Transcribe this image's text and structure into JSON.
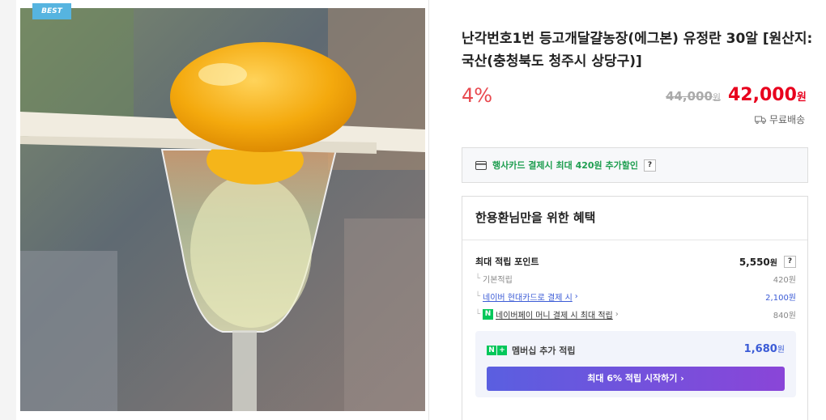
{
  "badge": "BEST",
  "product": {
    "title": "난각번호1번 등고개달걀농장(에그본) 유정란 30알 [원산지:국산(충청북도 청주시 상당구)]",
    "discount": "4%",
    "original_price": "44,000",
    "original_unit": "원",
    "sale_price": "42,000",
    "sale_unit": "원",
    "shipping": "무료배송"
  },
  "card_offer": {
    "text": "행사카드 결제시 최대 420원 추가할인",
    "help": "?"
  },
  "benefit": {
    "title": "한용환님만을 위한 혜택",
    "max_points_label": "최대 적립 포인트",
    "max_points_value": "5,550",
    "max_points_unit": "원",
    "help": "?",
    "rows": [
      {
        "label": "기본적립",
        "value": "420원"
      },
      {
        "label": "네이버 현대카드로 결제 시",
        "value": "2,100원"
      },
      {
        "label": "네이버페이 머니 결제 시 최대 적립",
        "value": "840원"
      }
    ],
    "npay_icon": "N",
    "member": {
      "label": "멤버십 추가 적립",
      "icon_n": "N",
      "icon_plus": "+",
      "value": "1,680",
      "unit": "원",
      "button": "최대 6% 적립 시작하기 ›"
    }
  },
  "colors": {
    "discount": "#e8484e",
    "price": "#e8001d",
    "card_text": "#1e9e50",
    "link": "#3b5bd6",
    "badge": "#56b4e0"
  }
}
